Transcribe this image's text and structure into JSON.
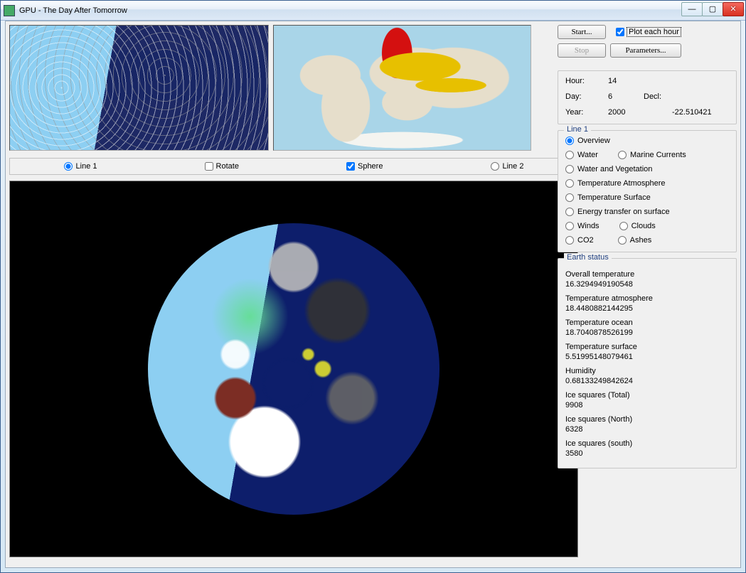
{
  "window": {
    "title": "GPU - The Day After Tomorrow"
  },
  "buttons": {
    "start": "Start...",
    "stop": "Stop",
    "parameters": "Parameters...",
    "plot_each_hour": "Plot each hour",
    "minimize": "—",
    "maximize": "▢",
    "close": "✕"
  },
  "time_status": {
    "hour_label": "Hour:",
    "hour_value": "14",
    "day_label": "Day:",
    "day_value": "6",
    "decl_label": "Decl:",
    "decl_value": "-22.510421",
    "year_label": "Year:",
    "year_value": "2000"
  },
  "view_controls": {
    "line1": "Line 1",
    "rotate": "Rotate",
    "sphere": "Sphere",
    "line2": "Line 2"
  },
  "line1_group": {
    "title": "Line 1",
    "options": {
      "overview": "Overview",
      "water": "Water",
      "marine_currents": "Marine Currents",
      "water_and_vegetation": "Water and Vegetation",
      "temperature_atmosphere": "Temperature Atmosphere",
      "temperature_surface": "Temperature Surface",
      "energy_transfer": "Energy transfer on surface",
      "winds": "Winds",
      "clouds": "Clouds",
      "co2": "CO2",
      "ashes": "Ashes"
    }
  },
  "earth_status": {
    "title": "Earth status",
    "items": [
      {
        "label": "Overall temperature",
        "value": "16.3294949190548"
      },
      {
        "label": "Temperature atmosphere",
        "value": "18.4480882144295"
      },
      {
        "label": "Temperature ocean",
        "value": "18.7040878526199"
      },
      {
        "label": "Temperature surface",
        "value": "5.51995148079461"
      },
      {
        "label": "Humidity",
        "value": "0.68133249842624"
      },
      {
        "label": "Ice squares (Total)",
        "value": "9908"
      },
      {
        "label": "Ice squares (North)",
        "value": "6328"
      },
      {
        "label": "Ice squares (south)",
        "value": "3580"
      }
    ]
  }
}
